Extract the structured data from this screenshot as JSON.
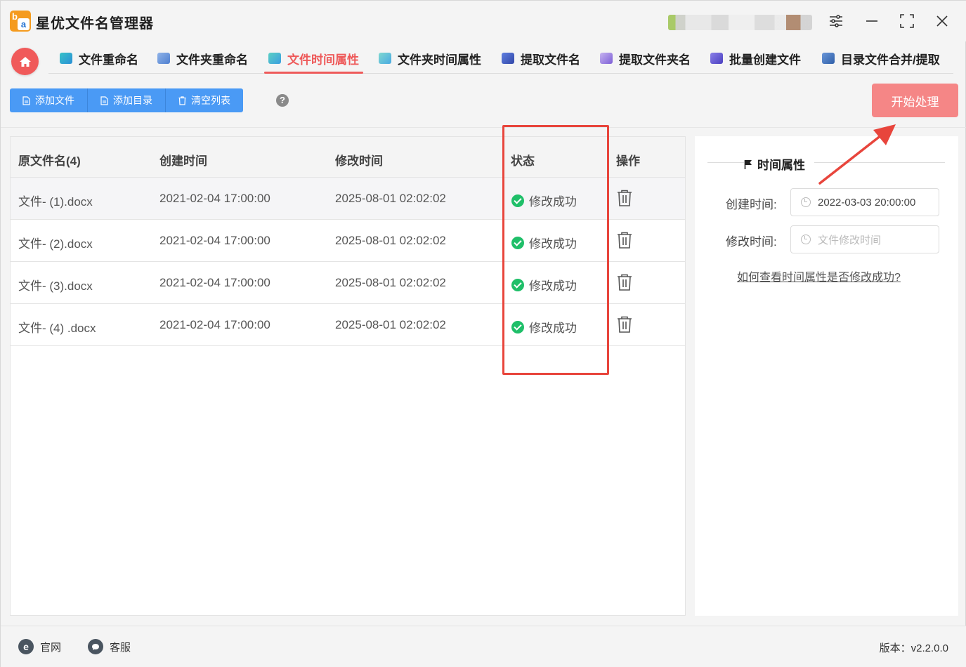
{
  "app": {
    "title": "星优文件名管理器",
    "logo_letters": [
      "b",
      "a"
    ],
    "window_controls": [
      "settings-icon",
      "minimize-icon",
      "maximize-icon",
      "close-icon"
    ]
  },
  "nav": {
    "tabs": [
      {
        "label": "文件重命名",
        "icon": "file-rename-icon"
      },
      {
        "label": "文件夹重命名",
        "icon": "folder-rename-icon"
      },
      {
        "label": "文件时间属性",
        "icon": "file-time-icon",
        "active": true
      },
      {
        "label": "文件夹时间属性",
        "icon": "folder-time-icon"
      },
      {
        "label": "提取文件名",
        "icon": "extract-filename-icon"
      },
      {
        "label": "提取文件夹名",
        "icon": "extract-foldername-icon"
      },
      {
        "label": "批量创建文件",
        "icon": "batch-create-icon"
      },
      {
        "label": "目录文件合并/提取",
        "icon": "merge-extract-icon"
      }
    ]
  },
  "toolbar": {
    "add_file": "添加文件",
    "add_dir": "添加目录",
    "clear_list": "清空列表",
    "help": "?",
    "start": "开始处理"
  },
  "table": {
    "headers": {
      "name": "原文件名(4)",
      "created": "创建时间",
      "modified": "修改时间",
      "status": "状态",
      "action": "操作"
    },
    "rows": [
      {
        "name": "文件- (1).docx",
        "created": "2021-02-04 17:00:00",
        "modified": "2025-08-01 02:02:02",
        "status": "修改成功"
      },
      {
        "name": "文件- (2).docx",
        "created": "2021-02-04 17:00:00",
        "modified": "2025-08-01 02:02:02",
        "status": "修改成功"
      },
      {
        "name": "文件- (3).docx",
        "created": "2021-02-04 17:00:00",
        "modified": "2025-08-01 02:02:02",
        "status": "修改成功"
      },
      {
        "name": "文件- (4) .docx",
        "created": "2021-02-04 17:00:00",
        "modified": "2025-08-01 02:02:02",
        "status": "修改成功"
      }
    ]
  },
  "panel": {
    "title": "时间属性",
    "created_label": "创建时间:",
    "created_value": "2022-03-03 20:00:00",
    "modified_label": "修改时间:",
    "modified_placeholder": "文件修改时间",
    "help_link": "如何查看时间属性是否修改成功?"
  },
  "footer": {
    "website": "官网",
    "website_icon": "e",
    "support": "客服",
    "version": "版本：v2.2.0.0"
  },
  "colors": {
    "accent_red": "#ee5a5a",
    "button_blue": "#4a9af5",
    "start_button": "#f58686",
    "success_green": "#1fbf69",
    "annotation_red": "#e8453c"
  }
}
